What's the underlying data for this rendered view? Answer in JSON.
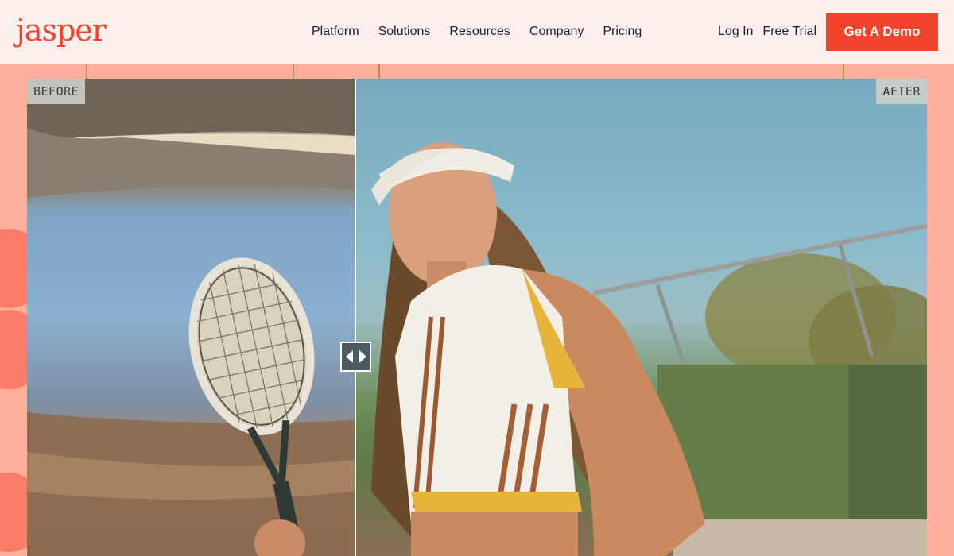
{
  "header": {
    "logo": "jasper",
    "nav": [
      "Platform",
      "Solutions",
      "Resources",
      "Company",
      "Pricing"
    ],
    "login_label": "Log In",
    "trial_label": "Free Trial",
    "demo_label": "Get A Demo"
  },
  "compare": {
    "before_label": "BEFORE",
    "after_label": "AFTER",
    "slider_position": 0.365
  },
  "colors": {
    "brand": "#f2442c",
    "page_bg": "#fdaf9c",
    "header_bg": "#fdf0ec",
    "nav_text": "#1b1f3b"
  },
  "icons": {
    "handle": "left-right-arrows-icon"
  }
}
